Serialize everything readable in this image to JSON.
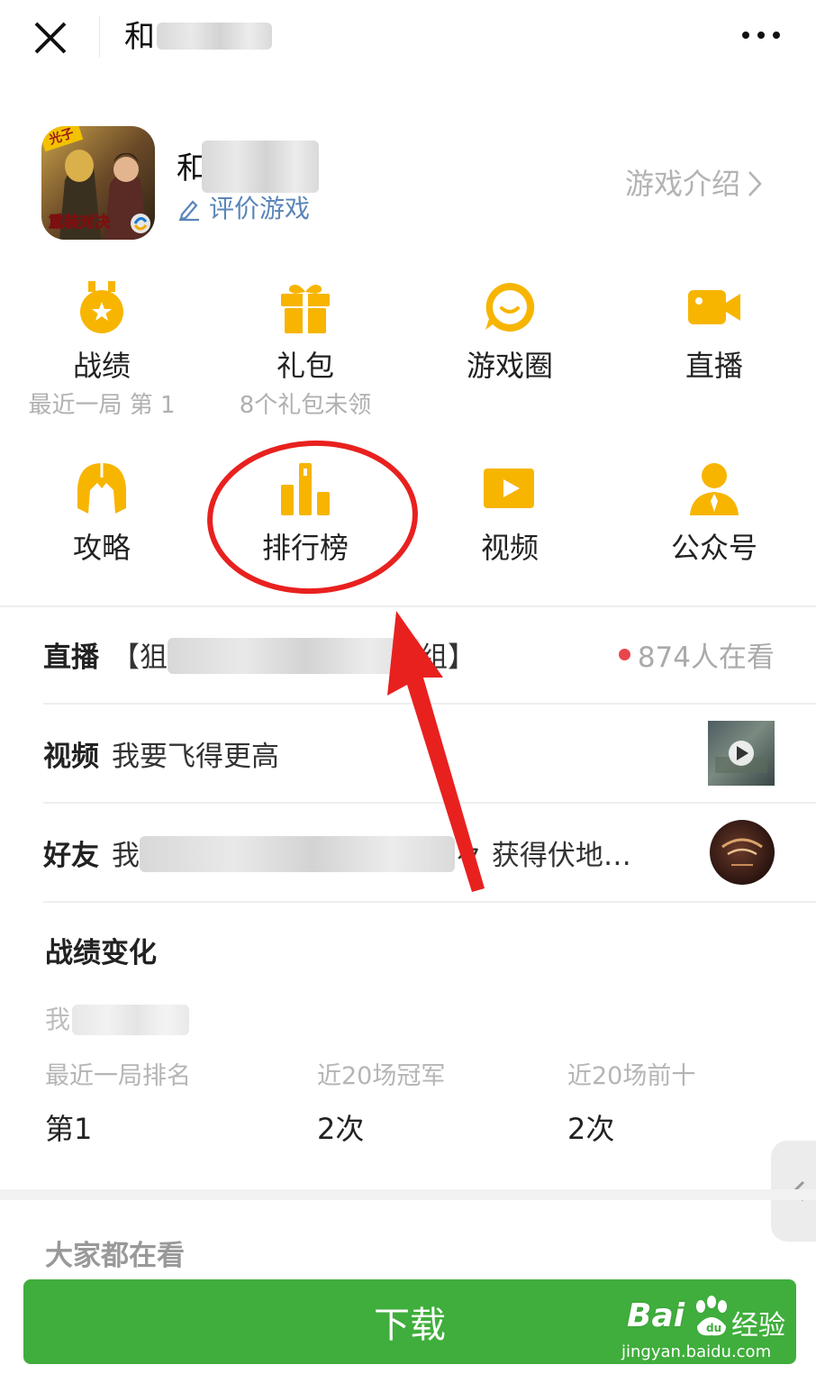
{
  "nav": {
    "title_visible": "和",
    "close_icon": "close-icon",
    "more_icon": "more-dots-icon"
  },
  "game": {
    "name_visible": "和",
    "rate_label": "评价游戏",
    "intro_label": "游戏介绍",
    "icon_text_top": "光子",
    "icon_text_bottom": "重装对决"
  },
  "grid": [
    {
      "key": "zhanji",
      "label": "战绩",
      "sub": "最近一局 第 1",
      "icon": "medal-icon"
    },
    {
      "key": "libao",
      "label": "礼包",
      "sub": "8个礼包未领",
      "icon": "gift-icon"
    },
    {
      "key": "youxiquan",
      "label": "游戏圈",
      "sub": "",
      "icon": "chat-bubble-icon"
    },
    {
      "key": "zhibo",
      "label": "直播",
      "sub": "",
      "icon": "video-camera-icon"
    },
    {
      "key": "gonglue",
      "label": "攻略",
      "sub": "",
      "icon": "helmet-icon"
    },
    {
      "key": "paihangbang",
      "label": "排行榜",
      "sub": "",
      "icon": "bar-chart-icon"
    },
    {
      "key": "shipin",
      "label": "视频",
      "sub": "",
      "icon": "play-icon"
    },
    {
      "key": "gongzhonghao",
      "label": "公众号",
      "sub": "",
      "icon": "person-icon"
    }
  ],
  "feed": [
    {
      "tag": "直播",
      "text_start": "【狙",
      "text_end": "组】",
      "meta": "874人在看"
    },
    {
      "tag": "视频",
      "text": "我要飞得更高"
    },
    {
      "tag": "好友",
      "text_start": "我",
      "text_end": "々 获得伏地…"
    }
  ],
  "record": {
    "title": "战绩变化",
    "user_visible": "我",
    "stats": [
      {
        "label": "最近一局排名",
        "value": "第1"
      },
      {
        "label": "近20场冠军",
        "value": "2次"
      },
      {
        "label": "近20场前十",
        "value": "2次"
      }
    ]
  },
  "more_section": {
    "title": "大家都在看"
  },
  "download": {
    "label": "下载"
  },
  "watermark": {
    "brand": "Bai",
    "product": "经验",
    "url": "jingyan.baidu.com"
  },
  "colors": {
    "accent_yellow": "#f7b500",
    "download_green": "#3fae3c",
    "annotation_red": "#e8211f",
    "link_blue": "#5a86b8"
  }
}
